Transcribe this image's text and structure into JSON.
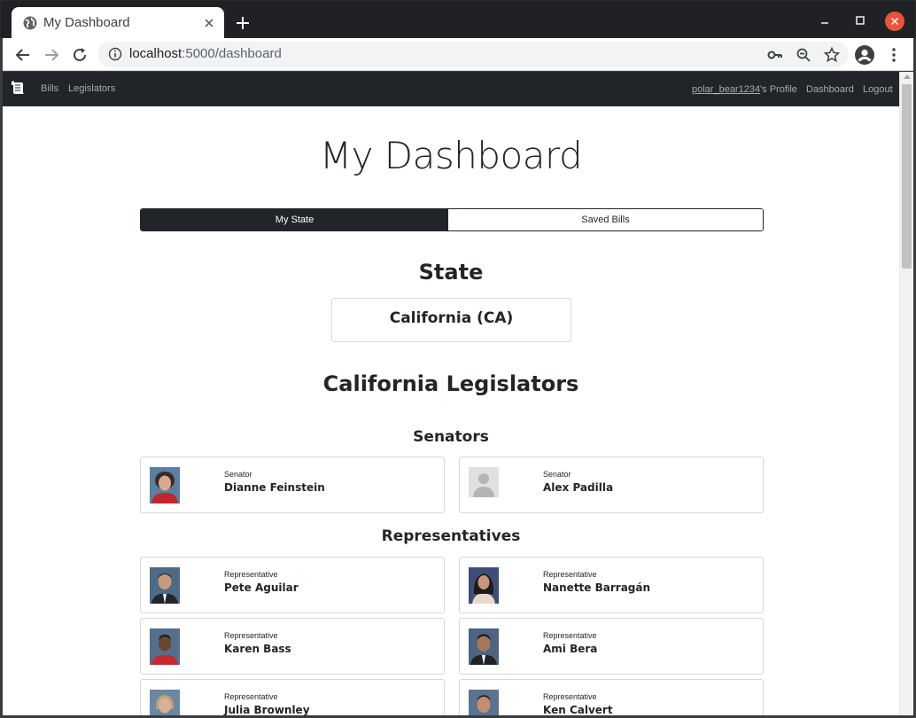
{
  "browser": {
    "tab_title": "My Dashboard",
    "url_host": "localhost",
    "url_path": ":5000/dashboard"
  },
  "navbar": {
    "links": [
      "Bills",
      "Legislators"
    ],
    "username": "polar_bear1234",
    "profile_suffix": "'s Profile",
    "dashboard": "Dashboard",
    "logout": "Logout"
  },
  "page": {
    "title": "My Dashboard",
    "tabs": [
      "My State",
      "Saved Bills"
    ],
    "active_tab": "My State"
  },
  "state_section": {
    "heading": "State",
    "state": "California (CA)"
  },
  "legislators": {
    "heading": "California Legislators",
    "senators_heading": "Senators",
    "senators": [
      {
        "role": "Senator",
        "name": "Dianne Feinstein",
        "photo": "portrait"
      },
      {
        "role": "Senator",
        "name": "Alex Padilla",
        "photo": "placeholder-avatar"
      }
    ],
    "reps_heading": "Representatives",
    "representatives": [
      {
        "role": "Representative",
        "name": "Pete Aguilar",
        "photo": "portrait"
      },
      {
        "role": "Representative",
        "name": "Nanette Barragán",
        "photo": "portrait"
      },
      {
        "role": "Representative",
        "name": "Karen Bass",
        "photo": "portrait"
      },
      {
        "role": "Representative",
        "name": "Ami Bera",
        "photo": "portrait"
      },
      {
        "role": "Representative",
        "name": "Julia Brownley",
        "photo": "portrait"
      },
      {
        "role": "Representative",
        "name": "Ken Calvert",
        "photo": "portrait"
      }
    ]
  },
  "colors": {
    "navbar_bg": "#212529",
    "text": "#212529",
    "card_border": "#d7d7d7",
    "close_button": "#e9543a"
  }
}
